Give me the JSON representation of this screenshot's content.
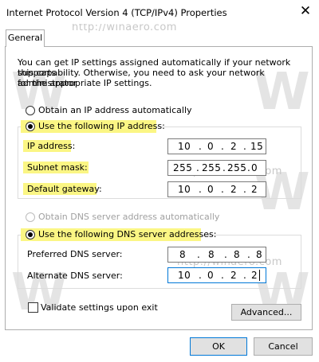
{
  "window": {
    "title": "Internet Protocol Version 4 (TCP/IPv4) Properties",
    "close_glyph": "✕"
  },
  "tabs": [
    {
      "label": "General",
      "selected": true
    }
  ],
  "intro_lines": [
    "You can get IP settings assigned automatically if your network supports",
    "this capability. Otherwise, you need to ask your network administrator",
    "for the appropriate IP settings."
  ],
  "ip_section": {
    "obtain_auto_label": "Obtain an IP address automatically",
    "use_following_label": "Use the following IP address:",
    "selected": "use_following",
    "fields": [
      {
        "label": "IP address:",
        "octets": [
          "10",
          "0",
          "2",
          "15"
        ]
      },
      {
        "label": "Subnet mask:",
        "octets": [
          "255",
          "255",
          "255",
          "0"
        ]
      },
      {
        "label": "Default gateway:",
        "octets": [
          "10",
          "0",
          "2",
          "2"
        ]
      }
    ]
  },
  "dns_section": {
    "obtain_auto_label": "Obtain DNS server address automatically",
    "use_following_label": "Use the following DNS server addresses:",
    "selected": "use_following",
    "fields": [
      {
        "label": "Preferred DNS server:",
        "octets": [
          "8",
          "8",
          "8",
          "8"
        ]
      },
      {
        "label": "Alternate DNS server:",
        "octets": [
          "10",
          "0",
          "2",
          "2"
        ]
      }
    ]
  },
  "validate": {
    "label": "Validate settings upon exit",
    "checked": false
  },
  "buttons": {
    "advanced": "Advanced...",
    "ok": "OK",
    "cancel": "Cancel"
  },
  "watermark": {
    "site": "http://winaero.com",
    "letter": "W"
  },
  "colors": {
    "highlight": "#fbf684",
    "accent": "#0078d7",
    "button_face": "#e1e1e1"
  }
}
